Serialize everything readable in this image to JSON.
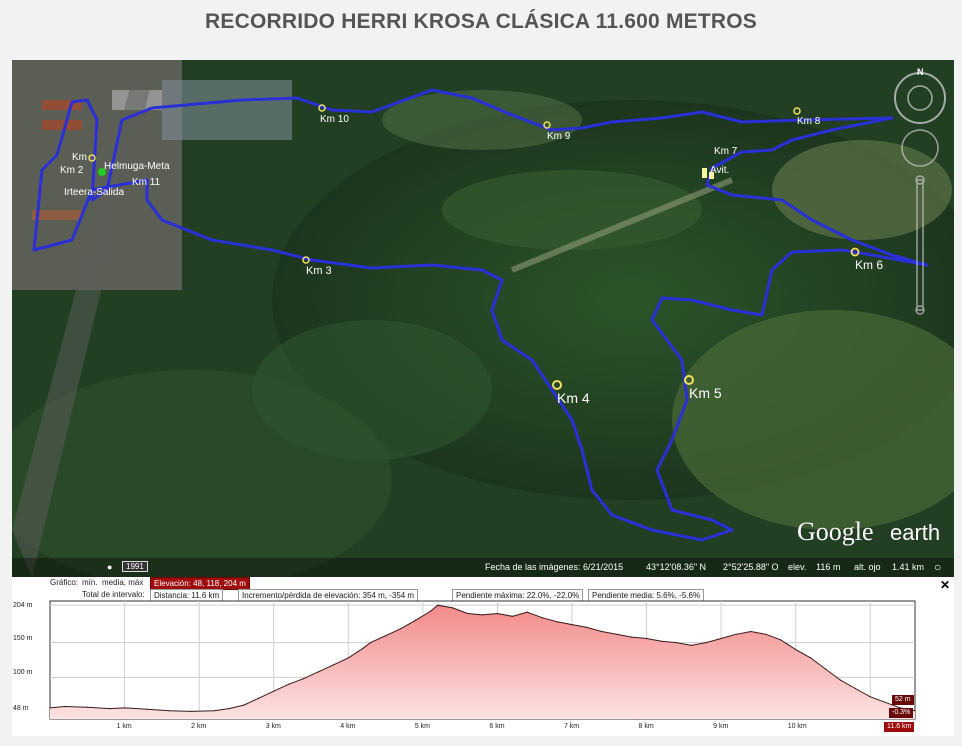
{
  "title": "RECORRIDO HERRI KROSA CLÁSICA 11.600 METROS",
  "map": {
    "labels": [
      {
        "id": "km10",
        "text": "Km 10"
      },
      {
        "id": "km9",
        "text": "Km 9"
      },
      {
        "id": "km8",
        "text": "Km 8"
      },
      {
        "id": "km7",
        "text": "Km 7"
      },
      {
        "id": "avit",
        "text": "Avit."
      },
      {
        "id": "km6",
        "text": "Km 6"
      },
      {
        "id": "km5",
        "text": "Km 5"
      },
      {
        "id": "km4",
        "text": "Km 4"
      },
      {
        "id": "km3",
        "text": "Km 3"
      },
      {
        "id": "km11",
        "text": "Km 11"
      },
      {
        "id": "km2",
        "text": "Km 2"
      },
      {
        "id": "km1",
        "text": "Km"
      },
      {
        "id": "meta",
        "text": "Helmuga-Meta"
      },
      {
        "id": "salida",
        "text": "Irteera-Salida"
      }
    ],
    "logo": {
      "google": "Google",
      "earth": "earth"
    },
    "year_badge": "1991",
    "status": {
      "date": "Fecha de las imágenes: 6/21/2015",
      "lat": "43°12'08.36\" N",
      "lon": "2°52'25.88\" O",
      "elev_label": "elev.",
      "elev": "116 m",
      "eye_label": "alt. ojo",
      "eye": "1.41 km"
    },
    "compass_letter": "N"
  },
  "profile": {
    "header": {
      "grafico": "Gráfico:",
      "min": "mín.",
      "media": "media, máx",
      "elevacion": "Elevación: 48, 118, 204 m",
      "total": "Total de intervalo:",
      "distancia": "Distancia: 11.6 km",
      "incremento": "Incremento/pérdida de elevación: 354 m, -354 m",
      "pend_max": "Pendiente máxima: 22.0%, -22.0%",
      "pend_media": "Pendiente media: 5.6%, -5.6%"
    },
    "y_labels": [
      "204 m",
      "150 m",
      "100 m",
      "48 m"
    ],
    "x_labels": [
      "1 km",
      "2 km",
      "3 km",
      "4 km",
      "5 km",
      "6 km",
      "7 km",
      "8 km",
      "9 km",
      "10 km"
    ],
    "end_labels": {
      "elev": "52 m",
      "slope": "-0.3%",
      "dist": "11.6 km"
    }
  },
  "chart_data": {
    "type": "area",
    "xlabel": "",
    "ylabel": "",
    "x_unit": "km",
    "y_unit": "m",
    "xlim": [
      0,
      11.6
    ],
    "ylim": [
      40,
      210
    ],
    "x": [
      0,
      0.2,
      0.5,
      0.8,
      1.0,
      1.3,
      1.6,
      1.9,
      2.2,
      2.4,
      2.6,
      2.8,
      3.0,
      3.2,
      3.4,
      3.6,
      3.8,
      4.0,
      4.2,
      4.3,
      4.5,
      4.7,
      4.9,
      5.1,
      5.2,
      5.4,
      5.6,
      5.8,
      6.0,
      6.2,
      6.4,
      6.6,
      6.8,
      7.0,
      7.2,
      7.4,
      7.6,
      7.8,
      8.0,
      8.2,
      8.4,
      8.6,
      8.8,
      9.0,
      9.2,
      9.4,
      9.6,
      9.8,
      10.0,
      10.2,
      10.4,
      10.6,
      10.8,
      11.0,
      11.2,
      11.4,
      11.6
    ],
    "y": [
      56,
      58,
      57,
      55,
      56,
      54,
      52,
      51,
      52,
      55,
      60,
      70,
      80,
      90,
      98,
      108,
      118,
      128,
      142,
      150,
      160,
      170,
      182,
      195,
      204,
      200,
      192,
      190,
      192,
      188,
      194,
      186,
      180,
      176,
      172,
      166,
      162,
      158,
      156,
      152,
      150,
      146,
      150,
      156,
      162,
      166,
      162,
      154,
      140,
      128,
      112,
      96,
      84,
      72,
      64,
      56,
      52
    ],
    "series": [
      {
        "values": "y"
      }
    ],
    "grid": true,
    "summary": {
      "min": 48,
      "mean": 118,
      "max": 204,
      "distance_km": 11.6,
      "gain_m": 354,
      "loss_m": -354,
      "max_slope": "22.0%, -22.0%",
      "avg_slope": "5.6%, -5.6%"
    }
  },
  "colors": {
    "route": "#2a2fd6",
    "profile_fill": "#f7b7b7",
    "profile_line": "#3a1a1a",
    "marker": "#f0e060"
  }
}
